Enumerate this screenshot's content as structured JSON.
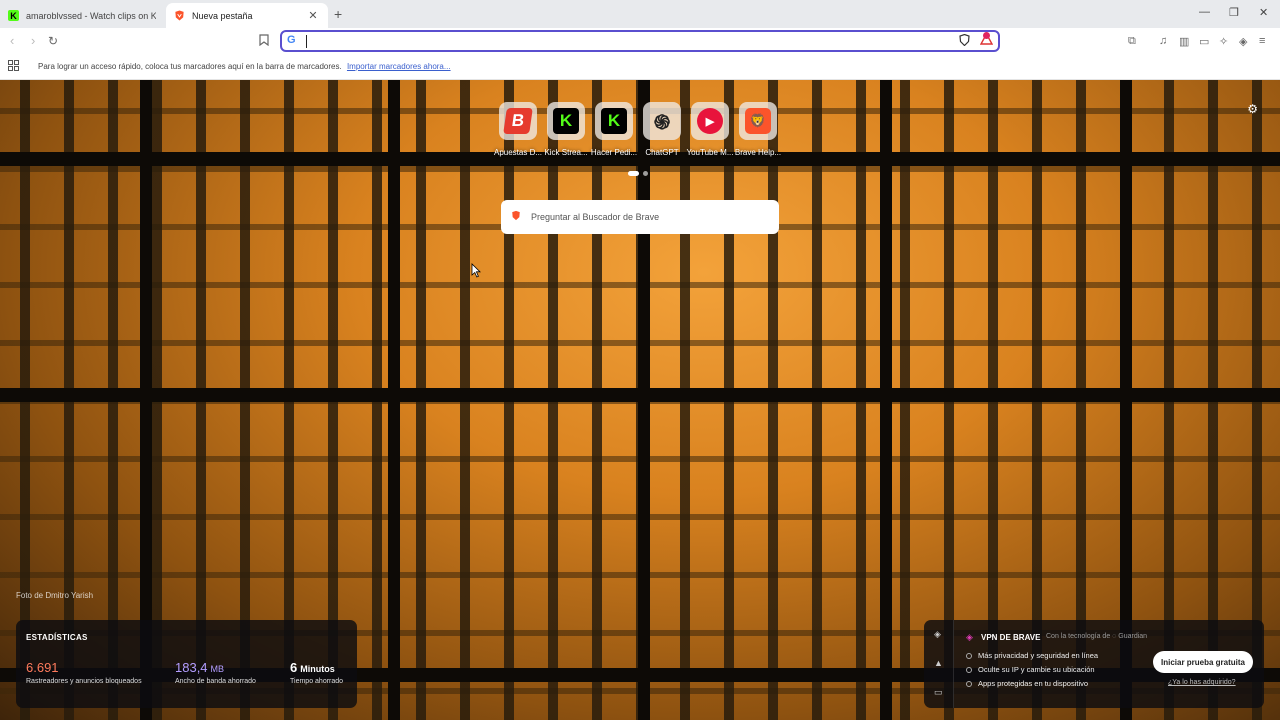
{
  "tabs": [
    {
      "title": "amaroblvssed - Watch clips on Kick",
      "icon": "kick-icon"
    },
    {
      "title": "Nueva pestaña",
      "icon": "brave-icon"
    }
  ],
  "omnibox": {
    "value": "",
    "search_engine": "G"
  },
  "bookmarks_bar": {
    "message": "Para lograr un acceso rápido, coloca tus marcadores aquí en la barra de marcadores.",
    "import_link": "Importar marcadores ahora..."
  },
  "top_sites": [
    {
      "label": "Apuestas D...",
      "glyph": "B"
    },
    {
      "label": "Kick Strea...",
      "glyph": "K"
    },
    {
      "label": "Hacer Pedi...",
      "glyph": "K"
    },
    {
      "label": "ChatGPT",
      "glyph": "֍"
    },
    {
      "label": "YouTube M...",
      "glyph": "▶"
    },
    {
      "label": "Brave Help...",
      "glyph": "🦁"
    }
  ],
  "search": {
    "placeholder": "Preguntar al Buscador de Brave"
  },
  "photo_credit": "Foto de Dmitro Yarish",
  "stats": {
    "title": "ESTADÍSTICAS",
    "trackers": {
      "value": "6.691",
      "unit": "",
      "label": "Rastreadores y anuncios bloqueados",
      "color": "#ff7a5c"
    },
    "bandwidth": {
      "value": "183,4",
      "unit": "MB",
      "label": "Ancho de banda ahorrado",
      "color": "#b39dff"
    },
    "time": {
      "value": "6",
      "unit": "Minutos",
      "label": "Tiempo ahorrado",
      "color": "#ffffff"
    }
  },
  "vpn": {
    "title": "VPN DE BRAVE",
    "powered_by": "Con la tecnología de ◌ Guardian",
    "features": [
      "Más privacidad y seguridad en línea",
      "Oculte su IP y cambie su ubicación",
      "Apps protegidas en tu dispositivo"
    ],
    "cta": "Iniciar prueba gratuita",
    "link": "¿Ya lo has adquirido?"
  },
  "colors": {
    "accent": "#5a4fcf",
    "brave": "#fb542b",
    "kick": "#53fc18"
  }
}
